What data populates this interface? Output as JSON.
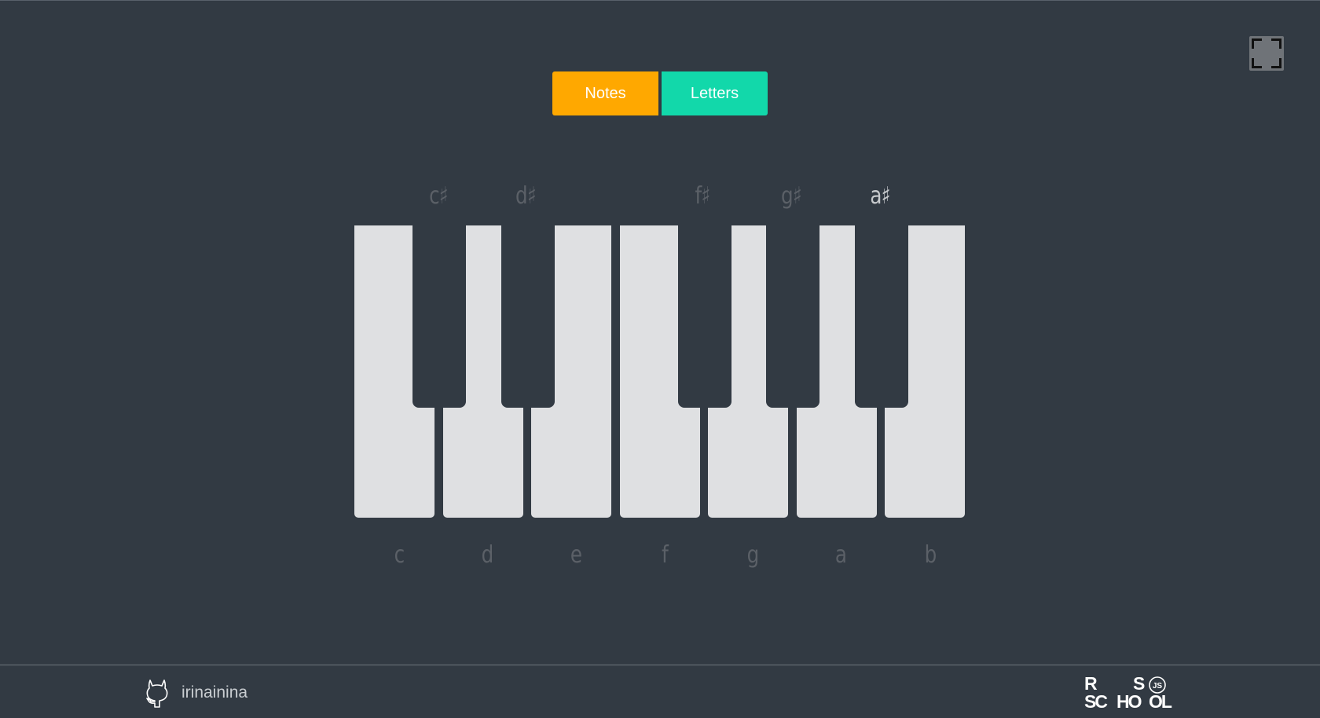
{
  "toolbar": {
    "notes_label": "Notes",
    "letters_label": "Letters",
    "active_mode": "Notes",
    "colors": {
      "notes": "#ffa800",
      "letters": "#12d8aa"
    }
  },
  "fullscreen": {
    "icon": "fullscreen-icon"
  },
  "piano": {
    "white_keys": [
      {
        "note": "c"
      },
      {
        "note": "d"
      },
      {
        "note": "e"
      },
      {
        "note": "f"
      },
      {
        "note": "g"
      },
      {
        "note": "a"
      },
      {
        "note": "b"
      }
    ],
    "black_keys": [
      {
        "note": "c♯"
      },
      {
        "note": "d♯"
      },
      {
        "note": "f♯"
      },
      {
        "note": "g♯"
      },
      {
        "note": "a♯"
      }
    ],
    "highlighted_note": "a♯"
  },
  "footer": {
    "github_user": "irinainina",
    "github_icon": "github-icon",
    "logo": {
      "row1_left": "R",
      "row1_right": "S",
      "row2_left": "SC",
      "row2_mid": "HO",
      "row2_right": "OL",
      "badge": "JS"
    }
  }
}
